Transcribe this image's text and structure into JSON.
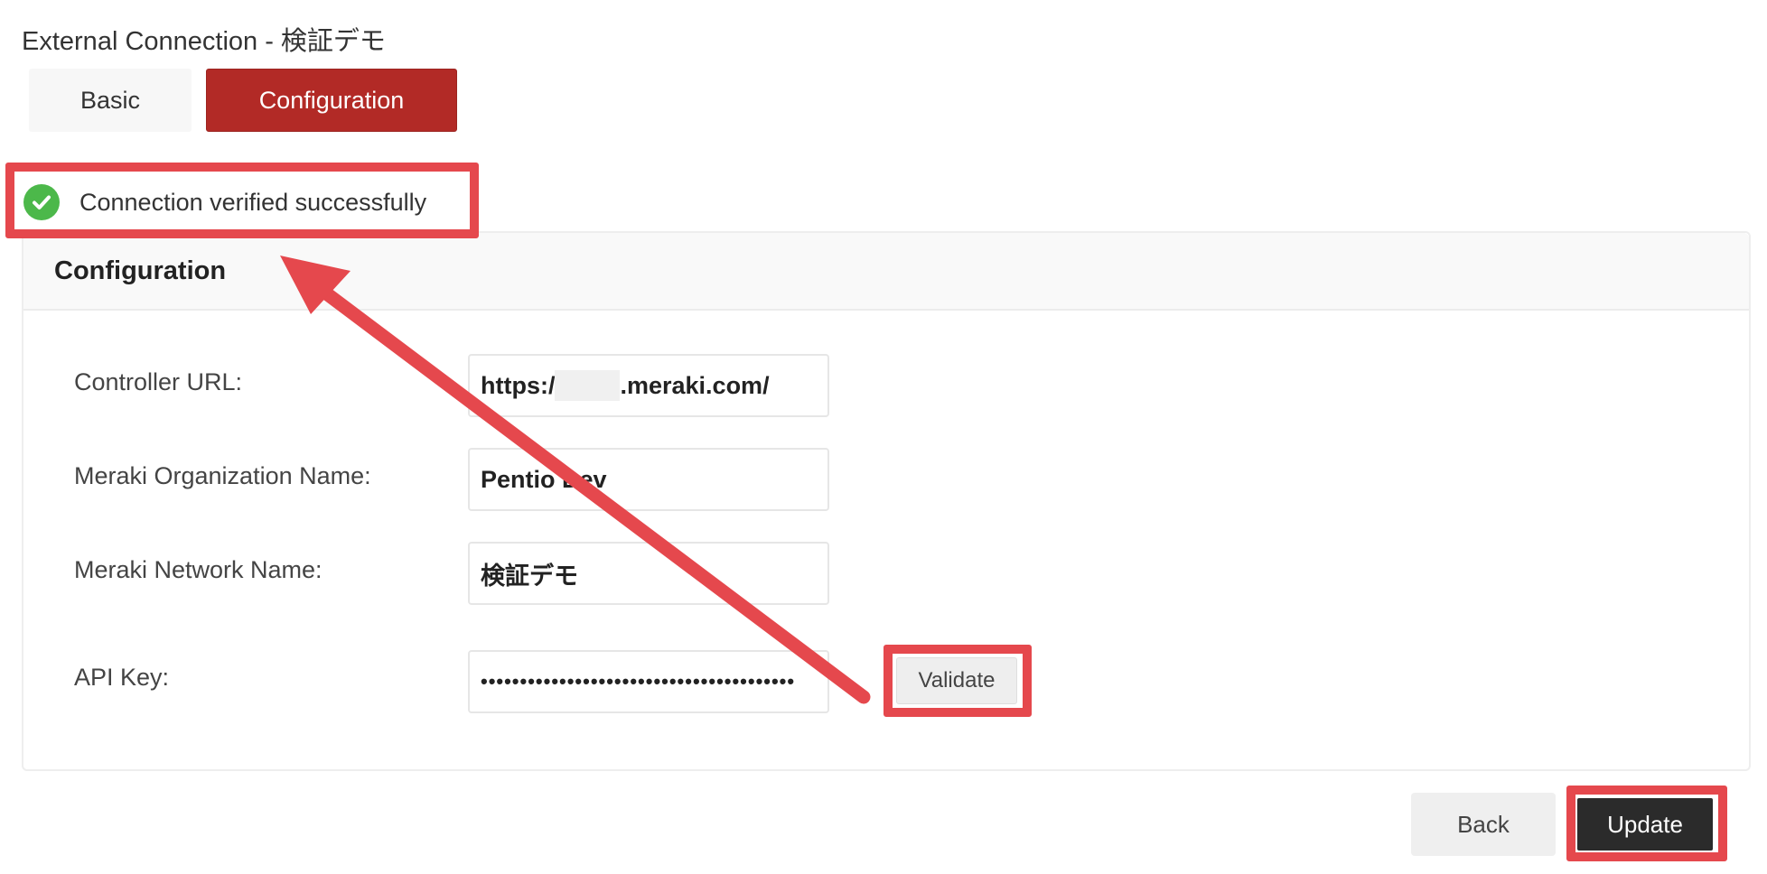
{
  "page": {
    "title": "External Connection - 検証デモ"
  },
  "tabs": [
    {
      "label": "Basic",
      "active": false
    },
    {
      "label": "Configuration",
      "active": true
    }
  ],
  "status": {
    "icon": "check-circle-icon",
    "message": "Connection verified successfully"
  },
  "panel": {
    "title": "Configuration",
    "fields": [
      {
        "label": "Controller URL:",
        "value_prefix": "https:/",
        "value_suffix": ".meraki.com/"
      },
      {
        "label": "Meraki Organization Name:",
        "value": "Pentio Dev"
      },
      {
        "label": "Meraki Network Name:",
        "value": "検証デモ"
      },
      {
        "label": "API Key:",
        "value": "••••••••••••••••••••••••••••••••••••••••"
      }
    ],
    "validate_label": "Validate"
  },
  "footer": {
    "back_label": "Back",
    "update_label": "Update"
  },
  "colors": {
    "accent": "#b22a26",
    "annotation": "#e5484d",
    "success": "#4cb84a",
    "primary_button": "#2b2b2b"
  }
}
